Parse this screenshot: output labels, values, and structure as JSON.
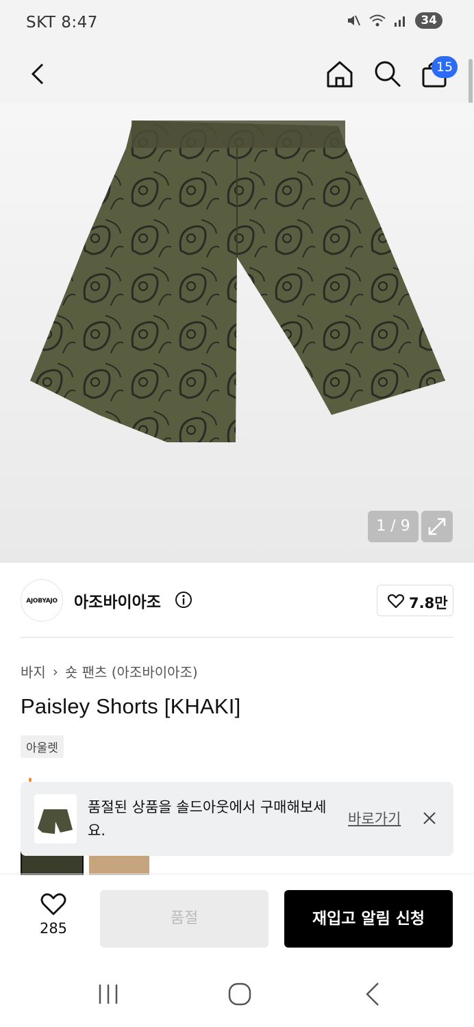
{
  "status_bar": {
    "carrier_time": "SKT 8:47",
    "battery": "34"
  },
  "header": {
    "cart_count": "15"
  },
  "gallery": {
    "counter": "1 / 9"
  },
  "brand": {
    "logo_text": "AJOBYAJO",
    "name": "아조바이아조",
    "likes": "7.8만"
  },
  "product": {
    "breadcrumb": [
      "바지",
      "숏 팬츠 (아조바이아조)"
    ],
    "title": "Paisley Shorts [KHAKI]",
    "tag": "아울렛"
  },
  "toast": {
    "message": "품절된 상품을 솔드아웃에서 구매해보세요.",
    "link": "바로가기"
  },
  "bottom_bar": {
    "wish_count": "285",
    "soldout_label": "품절",
    "restock_label": "재입고 알림 신청"
  },
  "colors": {
    "badge": "#2c6cf5",
    "primary_button": "#000000",
    "disabled_button": "#ebebeb"
  }
}
